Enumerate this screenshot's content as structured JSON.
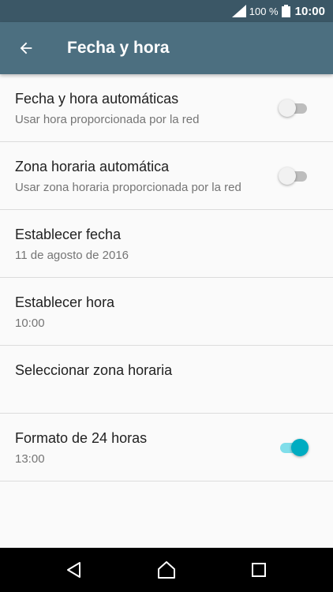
{
  "status_bar": {
    "battery_text": "100 %",
    "time": "10:00",
    "icons": [
      "signal-icon",
      "battery-icon"
    ]
  },
  "app_bar": {
    "title": "Fecha y hora",
    "back_icon": "arrow-back-icon"
  },
  "settings": {
    "items": [
      {
        "title": "Fecha y hora automáticas",
        "subtitle": "Usar hora proporcionada por la red",
        "toggle": "off"
      },
      {
        "title": "Zona horaria automática",
        "subtitle": "Usar zona horaria proporcionada por la red",
        "toggle": "off"
      },
      {
        "title": "Establecer fecha",
        "subtitle": "11 de agosto de 2016"
      },
      {
        "title": "Establecer hora",
        "subtitle": "10:00"
      },
      {
        "title": "Seleccionar zona horaria"
      },
      {
        "title": "Formato de 24 horas",
        "subtitle": "13:00",
        "toggle": "on"
      }
    ]
  },
  "nav_bar": {
    "icons": [
      "back-triangle-icon",
      "home-circle-icon",
      "recents-square-icon"
    ]
  },
  "colors": {
    "status_bar": "#3b5766",
    "app_bar": "#4c6f80",
    "background": "#fafafa",
    "accent": "#00acc1",
    "accent_track": "#80deea"
  }
}
